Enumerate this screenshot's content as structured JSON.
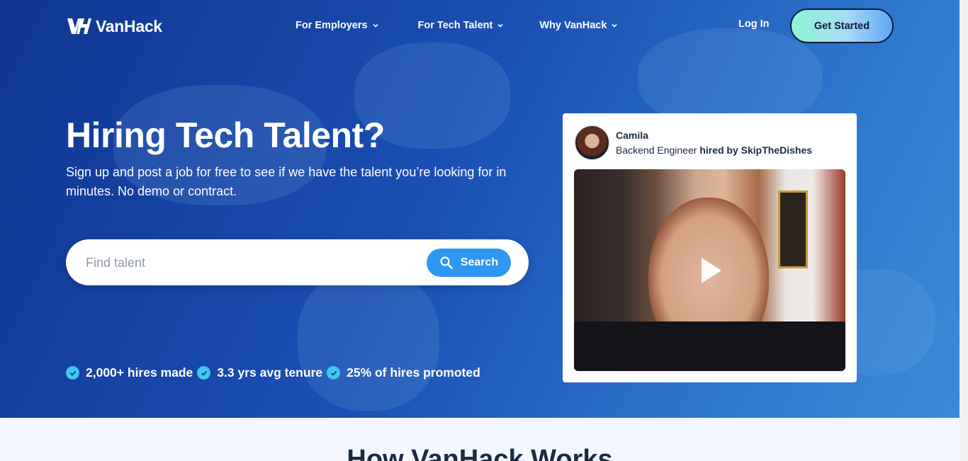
{
  "brand": {
    "name": "VanHack"
  },
  "nav": {
    "items": [
      {
        "label": "For Employers"
      },
      {
        "label": "For Tech Talent"
      },
      {
        "label": "Why VanHack"
      }
    ],
    "login": "Log In",
    "cta": "Get Started"
  },
  "hero": {
    "title": "Hiring Tech Talent?",
    "subtitle": "Sign up and post a job for free to see if we have the talent you’re looking for in minutes. No demo or contract.",
    "search": {
      "placeholder": "Find talent",
      "value": "",
      "button": "Search"
    },
    "stats": [
      "2,000+ hires made",
      "3.3 yrs avg tenure",
      "25% of hires promoted"
    ]
  },
  "testimonial": {
    "name": "Camila",
    "role": "Backend Engineer",
    "hired_prefix": "hired by",
    "company": "SkipTheDishes"
  },
  "section": {
    "title": "How VanHack Works"
  },
  "colors": {
    "accent": "#2e97f2",
    "check": "#3ec7f0",
    "hero_start": "#0f3591",
    "hero_end": "#3b8ad6"
  }
}
